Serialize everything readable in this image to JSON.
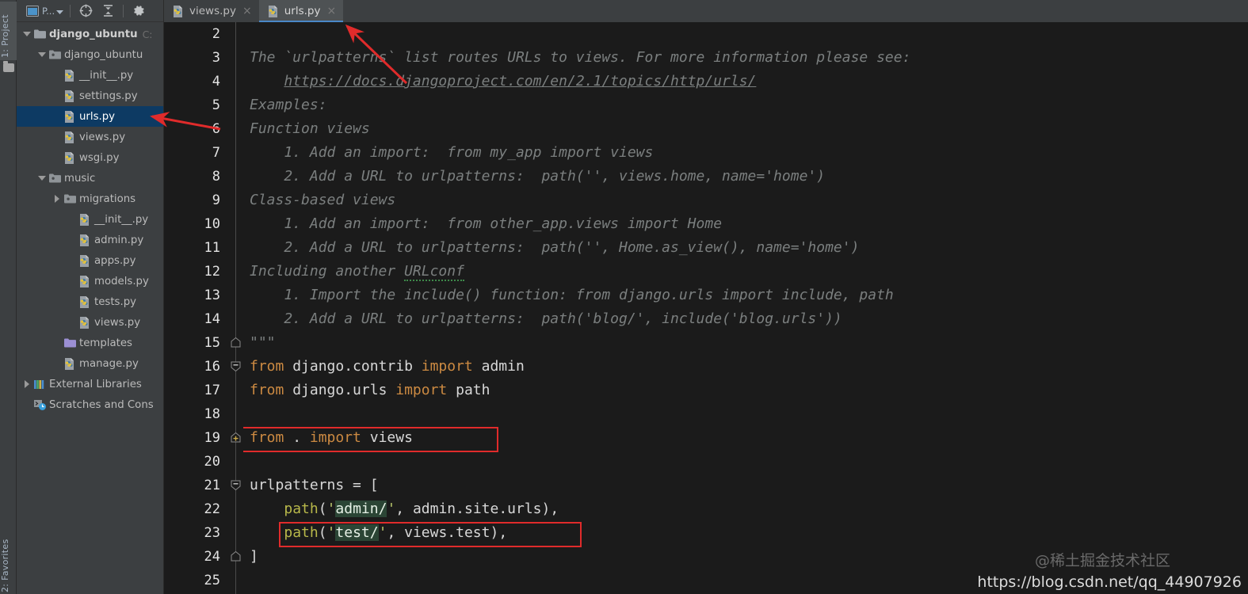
{
  "window": {
    "left_tool_tabs": [
      {
        "label": "1: Project",
        "icon": "project-panel-icon"
      },
      {
        "label": "2: Favorites",
        "icon": "favorites-icon"
      }
    ]
  },
  "project_toolbar": {
    "project_selector_label": "P...",
    "buttons": [
      {
        "name": "project-view-selector",
        "icon": "window-icon"
      },
      {
        "name": "scroll-from-source",
        "icon": "crosshair-target-icon"
      },
      {
        "name": "collapse-all",
        "icon": "collapse-all-icon"
      },
      {
        "name": "settings",
        "icon": "gear-icon"
      }
    ]
  },
  "project_tree": [
    {
      "label": "django_ubuntu",
      "sub": "C:",
      "icon": "folder-icon",
      "indent": 0,
      "twisty": "down",
      "bold": true,
      "selected": false
    },
    {
      "label": "django_ubuntu",
      "sub": "",
      "icon": "module-folder-icon",
      "indent": 1,
      "twisty": "down",
      "bold": false,
      "selected": false
    },
    {
      "label": "__init__.py",
      "sub": "",
      "icon": "python-file-icon",
      "indent": 2,
      "twisty": "none",
      "bold": false,
      "selected": false
    },
    {
      "label": "settings.py",
      "sub": "",
      "icon": "python-file-icon",
      "indent": 2,
      "twisty": "none",
      "bold": false,
      "selected": false
    },
    {
      "label": "urls.py",
      "sub": "",
      "icon": "python-file-icon",
      "indent": 2,
      "twisty": "none",
      "bold": false,
      "selected": true
    },
    {
      "label": "views.py",
      "sub": "",
      "icon": "python-file-icon",
      "indent": 2,
      "twisty": "none",
      "bold": false,
      "selected": false
    },
    {
      "label": "wsgi.py",
      "sub": "",
      "icon": "python-file-icon",
      "indent": 2,
      "twisty": "none",
      "bold": false,
      "selected": false
    },
    {
      "label": "music",
      "sub": "",
      "icon": "module-folder-icon",
      "indent": 1,
      "twisty": "down",
      "bold": false,
      "selected": false
    },
    {
      "label": "migrations",
      "sub": "",
      "icon": "module-folder-icon",
      "indent": 2,
      "twisty": "right",
      "bold": false,
      "selected": false
    },
    {
      "label": "__init__.py",
      "sub": "",
      "icon": "python-file-icon",
      "indent": 3,
      "twisty": "none",
      "bold": false,
      "selected": false
    },
    {
      "label": "admin.py",
      "sub": "",
      "icon": "python-file-icon",
      "indent": 3,
      "twisty": "none",
      "bold": false,
      "selected": false
    },
    {
      "label": "apps.py",
      "sub": "",
      "icon": "python-file-icon",
      "indent": 3,
      "twisty": "none",
      "bold": false,
      "selected": false
    },
    {
      "label": "models.py",
      "sub": "",
      "icon": "python-file-icon",
      "indent": 3,
      "twisty": "none",
      "bold": false,
      "selected": false
    },
    {
      "label": "tests.py",
      "sub": "",
      "icon": "python-file-icon",
      "indent": 3,
      "twisty": "none",
      "bold": false,
      "selected": false
    },
    {
      "label": "views.py",
      "sub": "",
      "icon": "python-file-icon",
      "indent": 3,
      "twisty": "none",
      "bold": false,
      "selected": false
    },
    {
      "label": "templates",
      "sub": "",
      "icon": "plain-folder-icon",
      "indent": 2,
      "twisty": "none",
      "bold": false,
      "selected": false
    },
    {
      "label": "manage.py",
      "sub": "",
      "icon": "python-file-icon",
      "indent": 2,
      "twisty": "none",
      "bold": false,
      "selected": false
    },
    {
      "label": "External Libraries",
      "sub": "",
      "icon": "libraries-icon",
      "indent": 0,
      "twisty": "right",
      "bold": false,
      "selected": false
    },
    {
      "label": "Scratches and Cons",
      "sub": "",
      "icon": "scratches-icon",
      "indent": 0,
      "twisty": "none",
      "bold": false,
      "selected": false
    }
  ],
  "editor_tabs": [
    {
      "label": "views.py",
      "icon": "python-file-icon",
      "active": false,
      "close": "×"
    },
    {
      "label": "urls.py",
      "icon": "python-file-icon",
      "active": true,
      "close": "×"
    }
  ],
  "editor": {
    "file": "urls.py",
    "first_visible_line": 2,
    "lines": [
      {
        "n": 2,
        "fold": "none",
        "segs": []
      },
      {
        "n": 3,
        "fold": "none",
        "segs": [
          {
            "t": "The `urlpatterns` list routes URLs to views. For more information please see:",
            "c": "cmt"
          }
        ]
      },
      {
        "n": 4,
        "fold": "none",
        "segs": [
          {
            "t": "    ",
            "c": "cmt"
          },
          {
            "t": "https://docs.djangoproject.com/en/2.1/topics/http/urls/",
            "c": "lnk"
          }
        ]
      },
      {
        "n": 5,
        "fold": "none",
        "segs": [
          {
            "t": "Examples:",
            "c": "cmt"
          }
        ]
      },
      {
        "n": 6,
        "fold": "none",
        "segs": [
          {
            "t": "Function views",
            "c": "cmt"
          }
        ]
      },
      {
        "n": 7,
        "fold": "none",
        "segs": [
          {
            "t": "    1. Add an import:  from my_app import views",
            "c": "cmt"
          }
        ]
      },
      {
        "n": 8,
        "fold": "none",
        "segs": [
          {
            "t": "    2. Add a URL to urlpatterns:  path('', views.home, name='home')",
            "c": "cmt"
          }
        ]
      },
      {
        "n": 9,
        "fold": "none",
        "segs": [
          {
            "t": "Class-based views",
            "c": "cmt"
          }
        ]
      },
      {
        "n": 10,
        "fold": "none",
        "segs": [
          {
            "t": "    1. Add an import:  from other_app.views import Home",
            "c": "cmt"
          }
        ]
      },
      {
        "n": 11,
        "fold": "none",
        "segs": [
          {
            "t": "    2. Add a URL to urlpatterns:  path('', Home.as_view(), name='home')",
            "c": "cmt"
          }
        ]
      },
      {
        "n": 12,
        "fold": "none",
        "segs": [
          {
            "t": "Including another ",
            "c": "cmt"
          },
          {
            "t": "URLconf",
            "c": "cmt squig"
          }
        ]
      },
      {
        "n": 13,
        "fold": "none",
        "segs": [
          {
            "t": "    1. Import the include() function: from django.urls import include, path",
            "c": "cmt"
          }
        ]
      },
      {
        "n": 14,
        "fold": "none",
        "segs": [
          {
            "t": "    2. Add a URL to urlpatterns:  path('blog/', include('blog.urls'))",
            "c": "cmt"
          }
        ]
      },
      {
        "n": 15,
        "fold": "end",
        "segs": [
          {
            "t": "\"\"\"",
            "c": "cmt"
          }
        ]
      },
      {
        "n": 16,
        "fold": "collapse",
        "segs": [
          {
            "t": "from",
            "c": "kw"
          },
          {
            "t": " django.contrib ",
            "c": "plain"
          },
          {
            "t": "import",
            "c": "kw"
          },
          {
            "t": " admin",
            "c": "plain"
          }
        ]
      },
      {
        "n": 17,
        "fold": "none",
        "segs": [
          {
            "t": "from",
            "c": "kw"
          },
          {
            "t": " django.urls ",
            "c": "plain"
          },
          {
            "t": "import",
            "c": "kw"
          },
          {
            "t": " path",
            "c": "plain"
          }
        ]
      },
      {
        "n": 18,
        "fold": "none",
        "segs": []
      },
      {
        "n": 19,
        "fold": "expand",
        "segs": [
          {
            "t": "from",
            "c": "kw"
          },
          {
            "t": " . ",
            "c": "plain"
          },
          {
            "t": "import",
            "c": "kw"
          },
          {
            "t": " views",
            "c": "plain"
          }
        ]
      },
      {
        "n": 20,
        "fold": "none",
        "segs": []
      },
      {
        "n": 21,
        "fold": "collapse",
        "segs": [
          {
            "t": "urlpatterns = [",
            "c": "plain"
          }
        ]
      },
      {
        "n": 22,
        "fold": "none",
        "segs": [
          {
            "t": "    ",
            "c": "plain"
          },
          {
            "t": "path",
            "c": "fn"
          },
          {
            "t": "(",
            "c": "plain"
          },
          {
            "t": "'",
            "c": "str"
          },
          {
            "t": "admin/",
            "c": "str str-hl"
          },
          {
            "t": "'",
            "c": "str"
          },
          {
            "t": ", admin.site.urls),",
            "c": "plain"
          }
        ]
      },
      {
        "n": 23,
        "fold": "none",
        "segs": [
          {
            "t": "    ",
            "c": "plain"
          },
          {
            "t": "path",
            "c": "fn"
          },
          {
            "t": "(",
            "c": "plain"
          },
          {
            "t": "'",
            "c": "str"
          },
          {
            "t": "test/",
            "c": "str str-hl"
          },
          {
            "t": "'",
            "c": "str"
          },
          {
            "t": ", views.test),",
            "c": "plain"
          }
        ]
      },
      {
        "n": 24,
        "fold": "end",
        "segs": [
          {
            "t": "]",
            "c": "plain"
          }
        ]
      },
      {
        "n": 25,
        "fold": "none",
        "segs": []
      }
    ]
  },
  "annotations": {
    "highlight_boxes": [
      {
        "name": "import-views-highlight",
        "target_line": 19
      },
      {
        "name": "path-test-highlight",
        "target_line": 23
      }
    ],
    "arrows": [
      {
        "name": "arrow-to-urls-tab",
        "points_to": "urls.py editor tab"
      },
      {
        "name": "arrow-to-urls-file",
        "points_to": "urls.py in project tree"
      }
    ],
    "color": "#e02b2b"
  },
  "watermark": {
    "line1": "@稀土掘金技术社区",
    "line2": "https://blog.csdn.net/qq_44907926"
  },
  "colors": {
    "editor_bg": "#1b1b1b",
    "panel_bg": "#3c3f41",
    "selection_bg": "#0d3a63",
    "accent": "#4a88c7",
    "annotation_red": "#e02b2b",
    "string_highlight": "#2b4535"
  }
}
